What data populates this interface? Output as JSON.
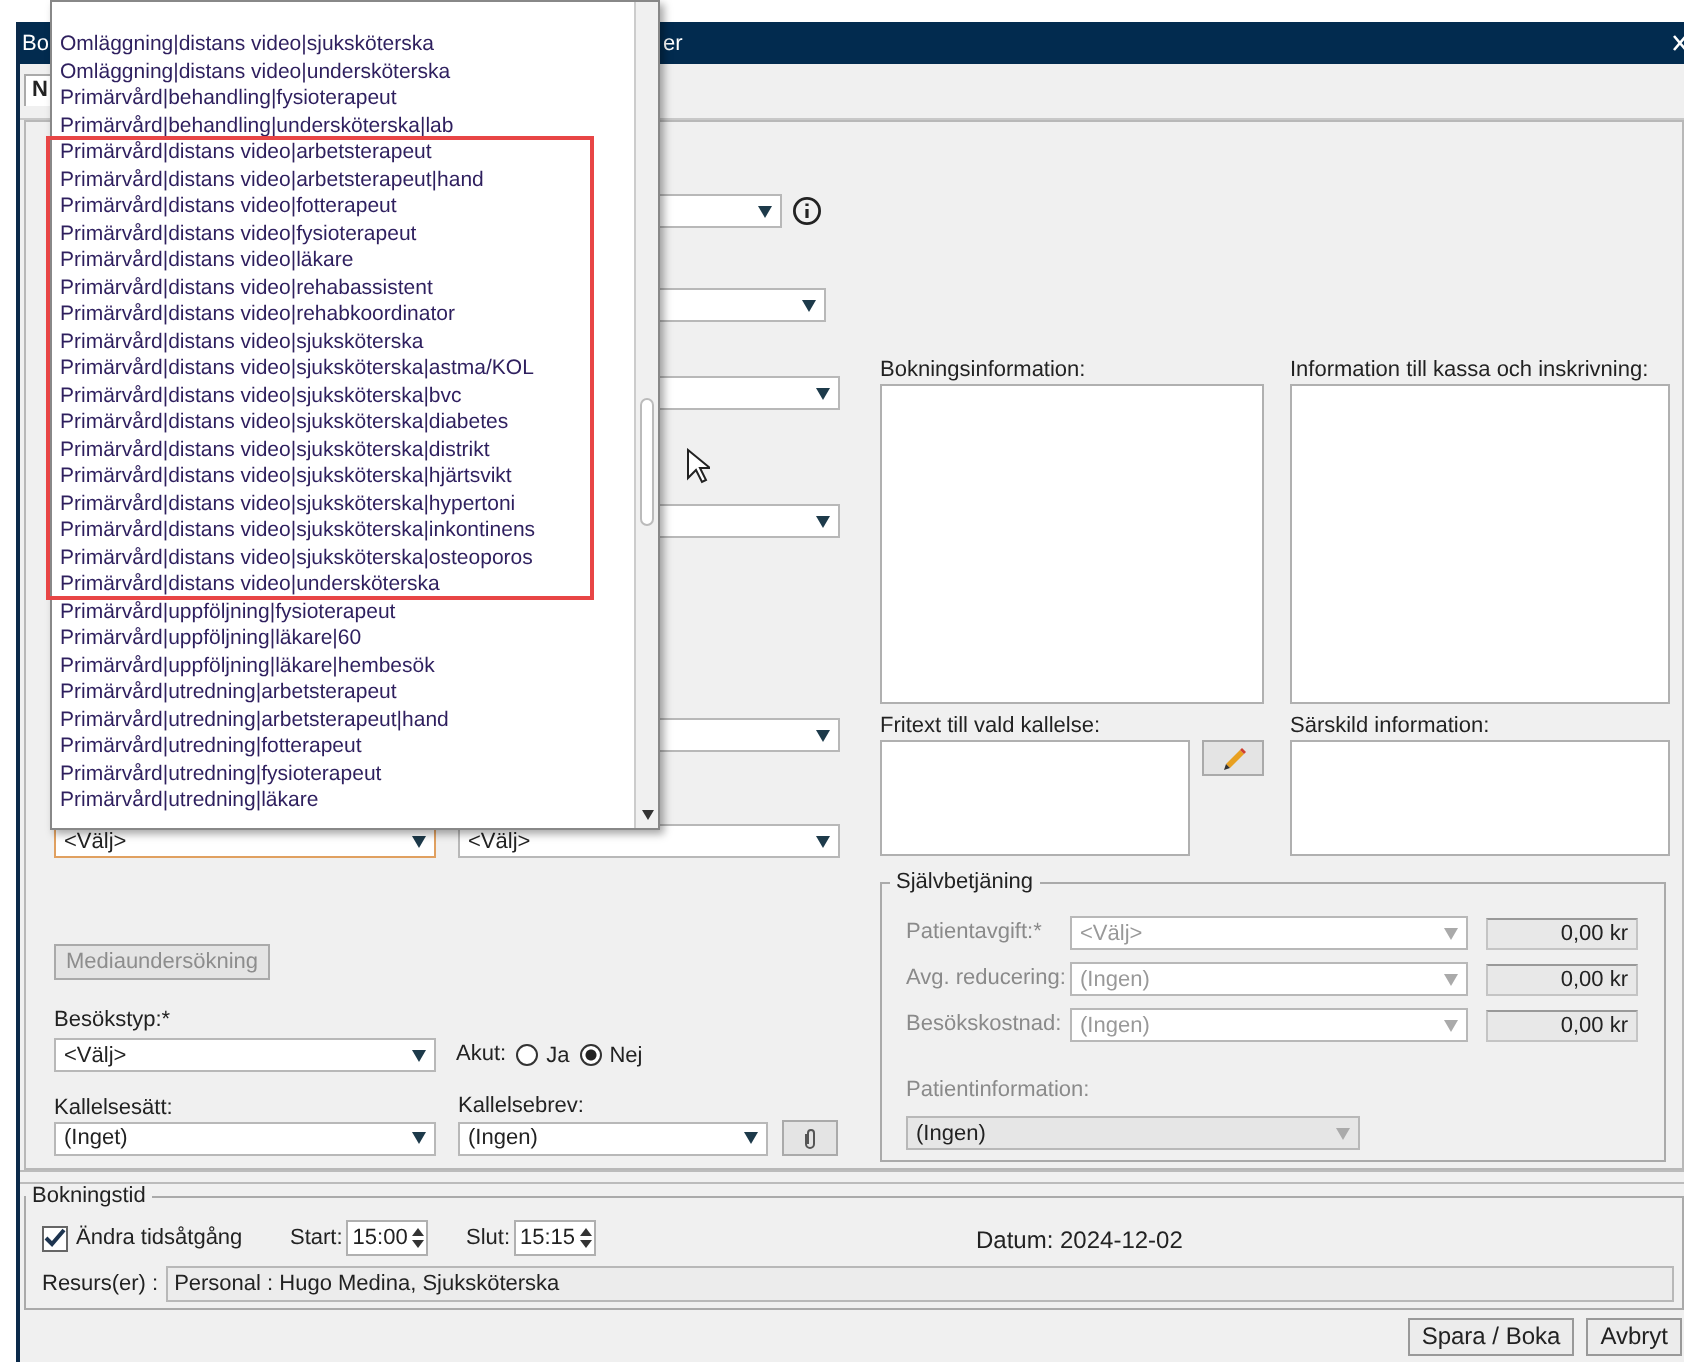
{
  "window": {
    "title_start": "Bo",
    "title_end": "er"
  },
  "tabs": [
    {
      "label": "N",
      "selected": true
    }
  ],
  "booking_form": {
    "visit_selects": [
      {
        "value": "<Välj>",
        "focused": true
      },
      {
        "value": "<Välj>",
        "focused": false
      }
    ],
    "media_button": {
      "label": "Mediaundersökning",
      "disabled": true
    },
    "visit_type": {
      "label": "Besökstyp:*",
      "value": "<Välj>"
    },
    "acute": {
      "label": "Akut:",
      "options": [
        {
          "label": "Ja",
          "selected": false
        },
        {
          "label": "Nej",
          "selected": true
        }
      ]
    },
    "notice_method": {
      "label": "Kallelsesätt:",
      "value": "(Inget)"
    },
    "notice_letter": {
      "label": "Kallelsebrev:",
      "value": "(Ingen)"
    },
    "notes": [
      {
        "label": "Bokningsinformation:"
      },
      {
        "label": "Information till kassa och inskrivning:"
      }
    ],
    "free_text": {
      "label": "Fritext till vald kallelse:"
    },
    "special_info": {
      "label": "Särskild information:"
    },
    "self_service": {
      "title": "Självbetjäning",
      "disabled": true,
      "rows": [
        {
          "label": "Patientavgift:*",
          "value": "<Välj>",
          "amount": "0,00 kr"
        },
        {
          "label": "Avg. reducering:",
          "value": "(Ingen)",
          "amount": "0,00 kr"
        },
        {
          "label": "Besökskostnad:",
          "value": "(Ingen)",
          "amount": "0,00 kr"
        }
      ],
      "patient_info": {
        "label": "Patientinformation:",
        "value": "(Ingen)"
      }
    }
  },
  "booking_time": {
    "title": "Bokningstid",
    "change_duration": {
      "label": "Ändra tidsåtgång",
      "checked": true
    },
    "start": {
      "label": "Start:",
      "value": "15:00"
    },
    "end": {
      "label": "Slut:",
      "value": "15:15"
    },
    "date": "Datum: 2024-12-02",
    "resources": {
      "label": "Resurs(er) :",
      "value": "Personal : Hugo Medina, Sjuksköterska"
    }
  },
  "buttons": [
    "Spara / Boka",
    "Avbryt"
  ],
  "dropdown_list": {
    "items": [
      "Omläggning|distans video|sjuksköterska",
      "Omläggning|distans video|undersköterska",
      "Primärvård|behandling|fysioterapeut",
      "Primärvård|behandling|undersköterska|lab",
      "Primärvård|distans video|arbetsterapeut",
      "Primärvård|distans video|arbetsterapeut|hand",
      "Primärvård|distans video|fotterapeut",
      "Primärvård|distans video|fysioterapeut",
      "Primärvård|distans video|läkare",
      "Primärvård|distans video|rehabassistent",
      "Primärvård|distans video|rehabkoordinator",
      "Primärvård|distans video|sjuksköterska",
      "Primärvård|distans video|sjuksköterska|astma/KOL",
      "Primärvård|distans video|sjuksköterska|bvc",
      "Primärvård|distans video|sjuksköterska|diabetes",
      "Primärvård|distans video|sjuksköterska|distrikt",
      "Primärvård|distans video|sjuksköterska|hjärtsvikt",
      "Primärvård|distans video|sjuksköterska|hypertoni",
      "Primärvård|distans video|sjuksköterska|inkontinens",
      "Primärvård|distans video|sjuksköterska|osteoporos",
      "Primärvård|distans video|undersköterska",
      "Primärvård|uppföljning|fysioterapeut",
      "Primärvård|uppföljning|läkare|60",
      "Primärvård|uppföljning|läkare|hembesök",
      "Primärvård|utredning|arbetsterapeut",
      "Primärvård|utredning|arbetsterapeut|hand",
      "Primärvård|utredning|fotterapeut",
      "Primärvård|utredning|fysioterapeut",
      "Primärvård|utredning|läkare"
    ]
  }
}
